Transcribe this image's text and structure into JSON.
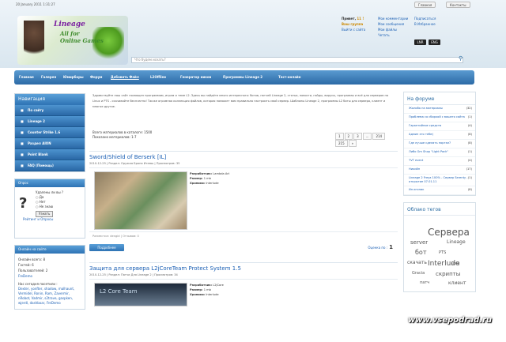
{
  "topbar": {
    "date": "20 January 2011 1:31:27",
    "btn_home": "Главная",
    "btn_contacts": "Контакты"
  },
  "logo": {
    "line1": "Lineage",
    "line2": "All for",
    "line3": "Online Games"
  },
  "user": {
    "greeting": "Привет,",
    "name": "11 !",
    "group": "Ваш группа",
    "logout": "Выйти с сайта"
  },
  "ulinks1": [
    "Мои комментарии",
    "Мои сообщения",
    "Мои файлы",
    "Четать"
  ],
  "ulinks2": [
    "Подписаться",
    "В Избранное"
  ],
  "mini": [
    "LNR",
    "ENG"
  ],
  "search": {
    "placeholder": "Что будем искать?",
    "icon": "search-icon"
  },
  "nav": [
    "Главная",
    "Галерея",
    "Юмирборы",
    "Форум",
    "Добавить Файл",
    "L2Offline",
    "Генератор ников",
    "Программы Lineage 2",
    "Тест-онлайн"
  ],
  "sidebar": {
    "nav_title": "Навигация",
    "menu": [
      "По сайту",
      "Lineage 2",
      "Counter Strike 1.6",
      "Раздел AION",
      "Point Blank",
      "FAQ (Помощь)"
    ],
    "poll_title": "Опрос",
    "poll_question": "Удалены ли вы ?",
    "poll_options": [
      "Да",
      "Нет",
      "Не знаю"
    ],
    "poll_button": "Узнать",
    "poll_links": "Рейтинг и Опросы",
    "online_title": "Онлайн на сайте",
    "online_lines": [
      "Онлайн всего: 8",
      "Гостей: 6",
      "Пользователей: 2",
      "FreDemo"
    ],
    "online_today_label": "Нас сегодня посетили :",
    "online_today": "Dexter, yonfter, shadow, malhaunt, Vermidel, Ronin, Ram, Zavermir, nRobot, Vadmir, s2trave, gaspken, wjerdl, dashboar, FreDemo"
  },
  "main": {
    "intro": "Здравствуйте наш сайт посвящен программам, играм и теме L2. Здесь вы найдёте много интересного: ботов, патчей Lineage 2, статьи, новости, гайды, вирусы, программы и всё для серверов на Linux и PTS - скачивайте бесплатно! Также огромная коллекция файлов, которая поможет вам правильно настроить свой сервер. Шаблоны Lineage 2, программы L2 боты для сервера, клиент и многое другое.",
    "stats1": "Всего материалов в каталоге: 1500",
    "stats2": "Показано материалов: 1-7",
    "pager": [
      "1",
      "2",
      "3",
      "...",
      "214",
      "215",
      "»"
    ],
    "articles": [
      {
        "title": "Sword/Shield of Berserk [IL]",
        "meta": "2010-12-25 | Раздел: Оружия Броня Итемы | Просмотров: 35",
        "dev_label": "Разработчик:",
        "dev": "Lambda Art",
        "size_label": "Размер:",
        "size": "1 mb",
        "chron_label": "Хроники:",
        "chron": "Interlude",
        "foot": "Разместил: dengid | Отзывов: 0"
      },
      {
        "title": "Защита для сервера L2jCoreTeam Protect System 1.5",
        "meta": "2010-12-25 | Раздел: Патчи Для Lineage 2 | Просмотров: 34",
        "dev_label": "Разработчик:",
        "dev": "L2jCore",
        "size_label": "Размер:",
        "size": "1 mb",
        "chron_label": "Хроники:",
        "chron": "Interlude",
        "thumb_text": "L2 Core Team"
      }
    ],
    "more_button": "Подробнее",
    "rating_label": "Оценка по :",
    "rating_value": "1"
  },
  "right": {
    "forum_title": "На форуме",
    "forum": [
      {
        "t": "Жалоба на материалы",
        "n": "(32)"
      },
      {
        "t": "Проблема со сборкой с вашего сайта",
        "n": "(1)"
      },
      {
        "t": "Гарантийное средств",
        "n": "(4)"
      },
      {
        "t": "Админ это тебе)",
        "n": "(8)"
      },
      {
        "t": "Где лучше сделать портал?",
        "n": "(8)"
      },
      {
        "t": "Либо Gm Shop \"Light Pack\"",
        "n": "(1)"
      },
      {
        "t": "TVT event",
        "n": "(4)"
      },
      {
        "t": "Никийн",
        "n": "(17)"
      },
      {
        "t": "Lineage 2 Freya 100% - Сервер Serenty - открытие 07.01.11",
        "n": "(1)"
      },
      {
        "t": "Ип игоник",
        "n": "(8)"
      }
    ],
    "cloud_title": "Облако тегов",
    "cloud": [
      "Сервера",
      "server",
      "Lineage",
      "бот",
      "PTS",
      "скачать",
      "Interlude",
      "java",
      "Gracia",
      "скрипты",
      "патч",
      "клиент"
    ]
  },
  "watermark": "www.vsepodrad.ru"
}
